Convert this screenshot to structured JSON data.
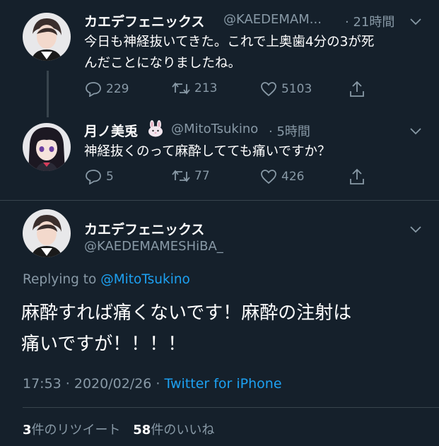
{
  "tweets": [
    {
      "display_name": "カエデフェニックス",
      "handle": "@KAEDEMAM...",
      "time": "· 21時間",
      "text_line1": "今日も神経抜いてきた。これで上奥歯4分の3が死",
      "text_line2": "んだことになりましたね。",
      "replies": "229",
      "retweets": "213",
      "likes": "5103"
    },
    {
      "display_name": "月ノ美兎",
      "handle": "@MitoTsukino",
      "time": "· 5時間",
      "text_line1": "神経抜くのって麻酔してても痛いですか？",
      "replies": "5",
      "retweets": "77",
      "likes": "426"
    }
  ],
  "focused": {
    "display_name": "カエデフェニックス",
    "handle": "@KAEDEMAMESHiBA_",
    "replying_prefix": "Replying to",
    "replying_handle": "@MitoTsukino",
    "text_line1": "麻酔すれば痛くないです！麻酔の注射は",
    "text_line2": "痛いですが！！！！",
    "timestamp": "17:53 · 2020/02/26 ·",
    "source": "Twitter for iPhone",
    "retweet_count": "3",
    "retweet_label": "件のリツイート",
    "like_count": "58",
    "like_label": "件のいいね"
  },
  "colors": {
    "background": "#15202b",
    "muted": "#8899a6",
    "link": "#1da1f2"
  }
}
